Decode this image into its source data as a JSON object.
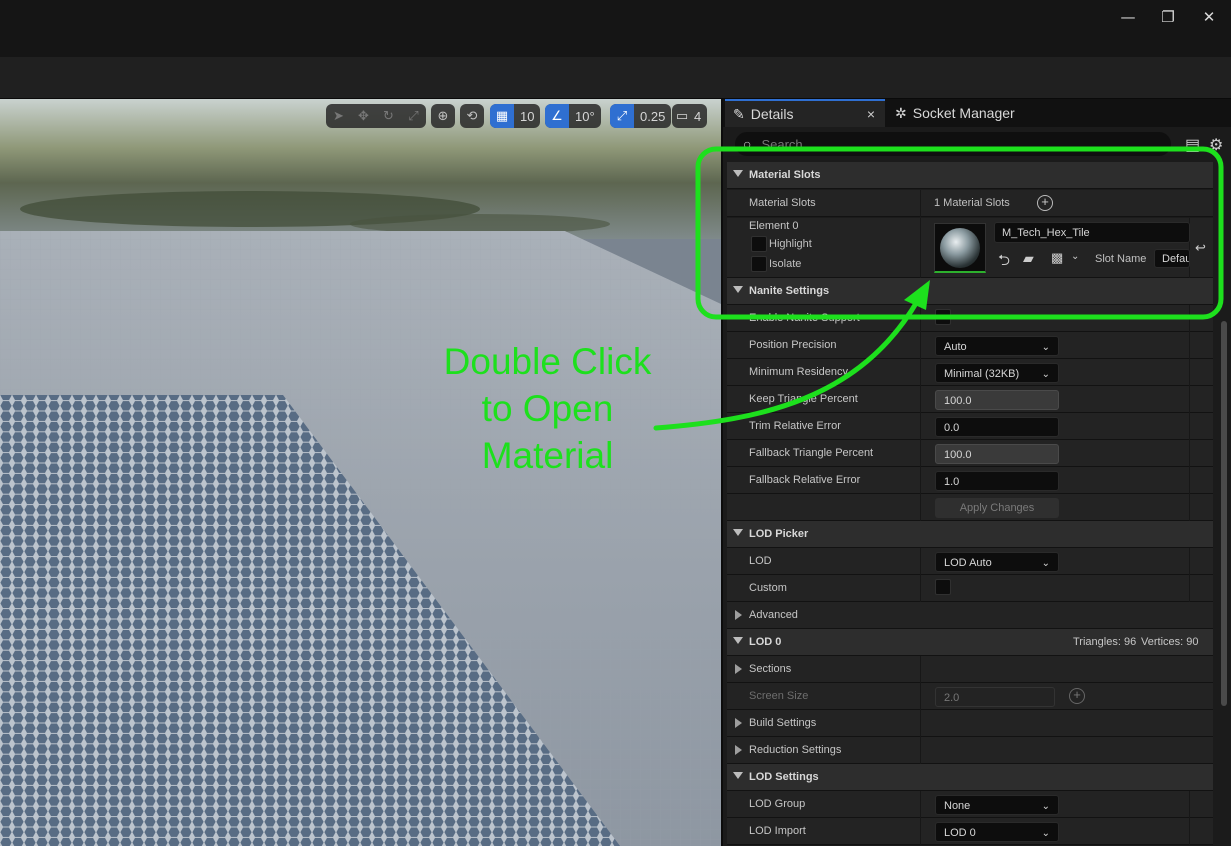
{
  "window": {
    "minimize": "—",
    "restore": "❐",
    "close": "✕"
  },
  "viewport_toolbar": {
    "grid_snap": "10",
    "rotation_snap": "10°",
    "scale_snap": "0.25",
    "camera_speed": "4"
  },
  "tabs": {
    "details": "Details",
    "socket_manager": "Socket Manager",
    "close": "×"
  },
  "search": {
    "placeholder": "Search"
  },
  "material_slots": {
    "header": "Material Slots",
    "row_label": "Material Slots",
    "count": "1 Material Slots",
    "element_label": "Element 0",
    "highlight_label": "Highlight",
    "isolate_label": "Isolate",
    "material_name": "M_Tech_Hex_Tile",
    "slot_name_label": "Slot Name",
    "slot_name_value": "Defau"
  },
  "nanite": {
    "header": "Nanite Settings",
    "enable_label": "Enable Nanite Support",
    "position_precision_label": "Position Precision",
    "position_precision_value": "Auto",
    "min_residency_label": "Minimum Residency",
    "min_residency_value": "Minimal (32KB)",
    "keep_triangle_label": "Keep Triangle Percent",
    "keep_triangle_value": "100.0",
    "trim_error_label": "Trim Relative Error",
    "trim_error_value": "0.0",
    "fallback_triangle_label": "Fallback Triangle Percent",
    "fallback_triangle_value": "100.0",
    "fallback_error_label": "Fallback Relative Error",
    "fallback_error_value": "1.0",
    "apply_button": "Apply Changes"
  },
  "lod_picker": {
    "header": "LOD Picker",
    "lod_label": "LOD",
    "lod_value": "LOD Auto",
    "custom_label": "Custom",
    "advanced_label": "Advanced"
  },
  "lod0": {
    "header": "LOD 0",
    "triangles": "Triangles: 96",
    "vertices": "Vertices: 90",
    "sections_label": "Sections",
    "screen_size_label": "Screen Size",
    "screen_size_value": "2.0",
    "build_settings_label": "Build Settings",
    "reduction_settings_label": "Reduction Settings"
  },
  "lod_settings": {
    "header": "LOD Settings",
    "lod_group_label": "LOD Group",
    "lod_group_value": "None",
    "lod_import_label": "LOD Import",
    "lod_import_value": "LOD 0"
  },
  "annotation": {
    "line1": "Double Click",
    "line2": "to Open",
    "line3": "Material",
    "color": "#1de01d"
  },
  "colors": {
    "accent": "#2f6fd1",
    "highlight_box": "#1de01d"
  }
}
